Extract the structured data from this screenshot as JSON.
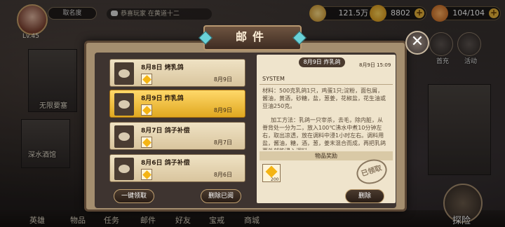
{
  "profile": {
    "name": "取名度",
    "level": "Lv.45"
  },
  "ticker": {
    "text": "恭喜玩家 在黄道十二"
  },
  "resources": [
    {
      "icon": "coin-icon",
      "value": "121.5万",
      "color": "#f2c24a"
    },
    {
      "icon": "diamond-icon",
      "value": "8802",
      "color": "#f4b414"
    },
    {
      "icon": "stamina-icon",
      "value": "104/104",
      "color": "#e8802a"
    }
  ],
  "map": {
    "labels": [
      "无限要塞",
      "深水酒馆"
    ]
  },
  "side": {
    "labels": [
      "首充",
      "活动"
    ]
  },
  "nav": {
    "items": [
      "英雄",
      "物品",
      "任务",
      "邮件",
      "好友",
      "宝戒",
      "商城"
    ],
    "explore": "探险"
  },
  "mail": {
    "title": "邮件",
    "items": [
      {
        "subject": "8月8日 烤乳鸽",
        "date": "8月9日",
        "selected": false
      },
      {
        "subject": "8月9日 炸乳鸽",
        "date": "8月9日",
        "selected": true
      },
      {
        "subject": "8月7日 鸽子补偿",
        "date": "8月7日",
        "selected": false
      },
      {
        "subject": "8月6日 鸽子补偿",
        "date": "8月6日",
        "selected": false
      }
    ],
    "claim_all": "一键领取",
    "delete_read": "删除已阅",
    "detail": {
      "title": "8月9日 炸乳鸽",
      "date": "8月9日 15:09",
      "sender": "SYSTEM",
      "materials": "材料：500克乳鸽1只，鸡蛋1只;淀粉，面包屑，酱油，黄酒，砂糖，盐，葱姜，花椒盐，花生油或豆油250克。",
      "method": "加工方法：乳鸽一只宰杀，去毛，除内脏，从脊背处一分为二，放入100℃沸水中煮10分钟左右，取出凉透，放在调料中浸1小时左右。调料用盐，酱油，糖，酒，葱，姜末混合而成，再把乳鸽两外部能浸入调料",
      "reward_header": "物品奖励",
      "reward_qty": "200",
      "claimed": "已领取",
      "delete": "删除"
    }
  }
}
